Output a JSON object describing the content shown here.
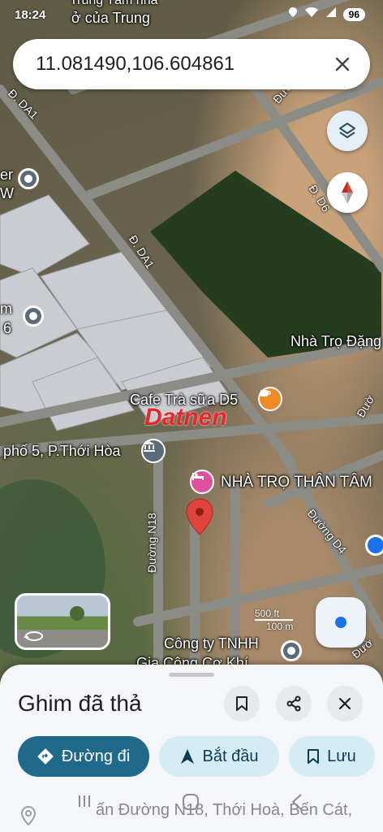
{
  "status_bar": {
    "time": "18:24",
    "battery": "96"
  },
  "search": {
    "value": "11.081490,106.604861"
  },
  "map": {
    "labels": {
      "top_poi_line1": "Trung Tâm nhà",
      "top_poi_line2": "ở của Trung",
      "factory_left1": "er",
      "factory_left2": "W",
      "factory_left3": "m",
      "factory_left4": "6",
      "nha_tro_dang": "Nhà Trọ Đặng",
      "cafe": "Cafe Trà sữa D5",
      "pho5": "phố 5, P.Thới Hòa",
      "nha_tro_than_tam": "NHÀ TRỌ THÂN TÂM",
      "cong_ty_line1": "Công ty TNHH",
      "cong_ty_line2": "Gia Công Cơ Khí",
      "watermark": "Datnen"
    },
    "streets": {
      "da1_top": "Đ. DA1",
      "da1_mid": "Đ. DA1",
      "d6": "Đ. D6",
      "duong_top": "Đườ",
      "duong_right": "Đườ",
      "n18": "Đường N18",
      "d4": "Đường D4",
      "duong_bottom_right": "Đườ"
    },
    "scale": {
      "ft": "500 ft",
      "m": "100 m"
    }
  },
  "sheet": {
    "title": "Ghim đã thả",
    "directions_label": "Đường đi",
    "start_label": "Bắt đầu",
    "save_label": "Lưu",
    "address": "ấn Đường N18, Thới Hoà, Bến Cát,"
  },
  "colors": {
    "accent": "#1f6a8a",
    "pin": "#e0443c",
    "poi_pink": "#e04f9c",
    "cafe": "#f08a24"
  }
}
